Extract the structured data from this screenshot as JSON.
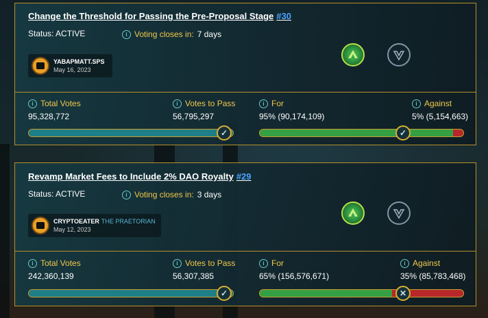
{
  "proposals": [
    {
      "title": "Change the Threshold for Passing the Pre-Proposal Stage",
      "number": "#30",
      "status": "Status: ACTIVE",
      "closes_label": "Voting closes in:",
      "closes_value": "7 days",
      "author_name": "YABAPMATT.SPS",
      "author_guild": "",
      "author_date": "May 16, 2023",
      "total_votes_label": "Total Votes",
      "total_votes": "95,328,772",
      "votes_to_pass_label": "Votes to Pass",
      "votes_to_pass": "56,795,297",
      "for_label": "For",
      "for_value": "95% (90,174,109)",
      "against_label": "Against",
      "against_value": "5% (5,154,663)",
      "pass_progress": 1.0,
      "for_fraction": 0.95,
      "status_icon": "check-icon"
    },
    {
      "title": "Revamp Market Fees to Include 2% DAO Royalty",
      "number": "#29",
      "status": "Status: ACTIVE",
      "closes_label": "Voting closes in:",
      "closes_value": "3 days",
      "author_name": "CRYPTOEATER",
      "author_guild": "THE PRAETORIAN",
      "author_date": "May 12, 2023",
      "total_votes_label": "Total Votes",
      "total_votes": "242,360,139",
      "votes_to_pass_label": "Votes to Pass",
      "votes_to_pass": "56,307,385",
      "for_label": "For",
      "for_value": "65% (156,576,671)",
      "against_label": "Against",
      "against_value": "35% (85,783,468)",
      "pass_progress": 1.0,
      "for_fraction": 0.65,
      "status_icon": "x-icon"
    }
  ],
  "colors": {
    "accent": "#b8902a",
    "label": "#f0c94a",
    "link": "#4aa3ff",
    "for": "#35a043",
    "against": "#b8272a",
    "pass": "#1f7f88"
  }
}
